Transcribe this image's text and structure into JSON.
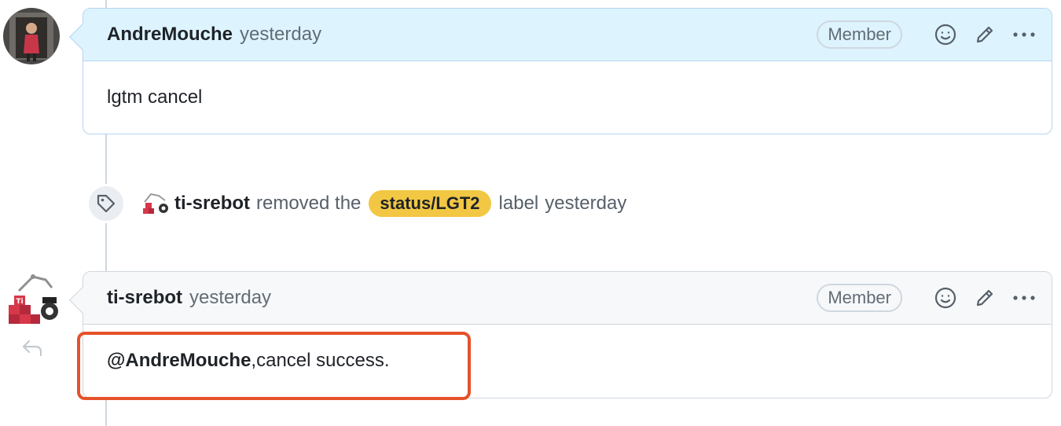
{
  "comments": [
    {
      "author": "AndreMouche",
      "time": "yesterday",
      "badge": "Member",
      "body": "lgtm cancel"
    },
    {
      "author": "ti-srebot",
      "time": "yesterday",
      "badge": "Member",
      "mention": "@AndreMouche",
      "body_rest": ",cancel success."
    }
  ],
  "event": {
    "actor": "ti-srebot",
    "action": "removed the",
    "label": "status/LGT2",
    "suffix": "label",
    "time": "yesterday",
    "label_color": "#f2c744"
  },
  "icons": {
    "event": "tag-icon",
    "emoji": "smiley-icon",
    "edit": "pencil-icon",
    "more": "kebab-horizontal-icon",
    "reply": "reply-icon"
  },
  "colors": {
    "highlight": "#e5522a",
    "header_blue": "#ddf4ff",
    "header_gray": "#f6f8fa"
  }
}
